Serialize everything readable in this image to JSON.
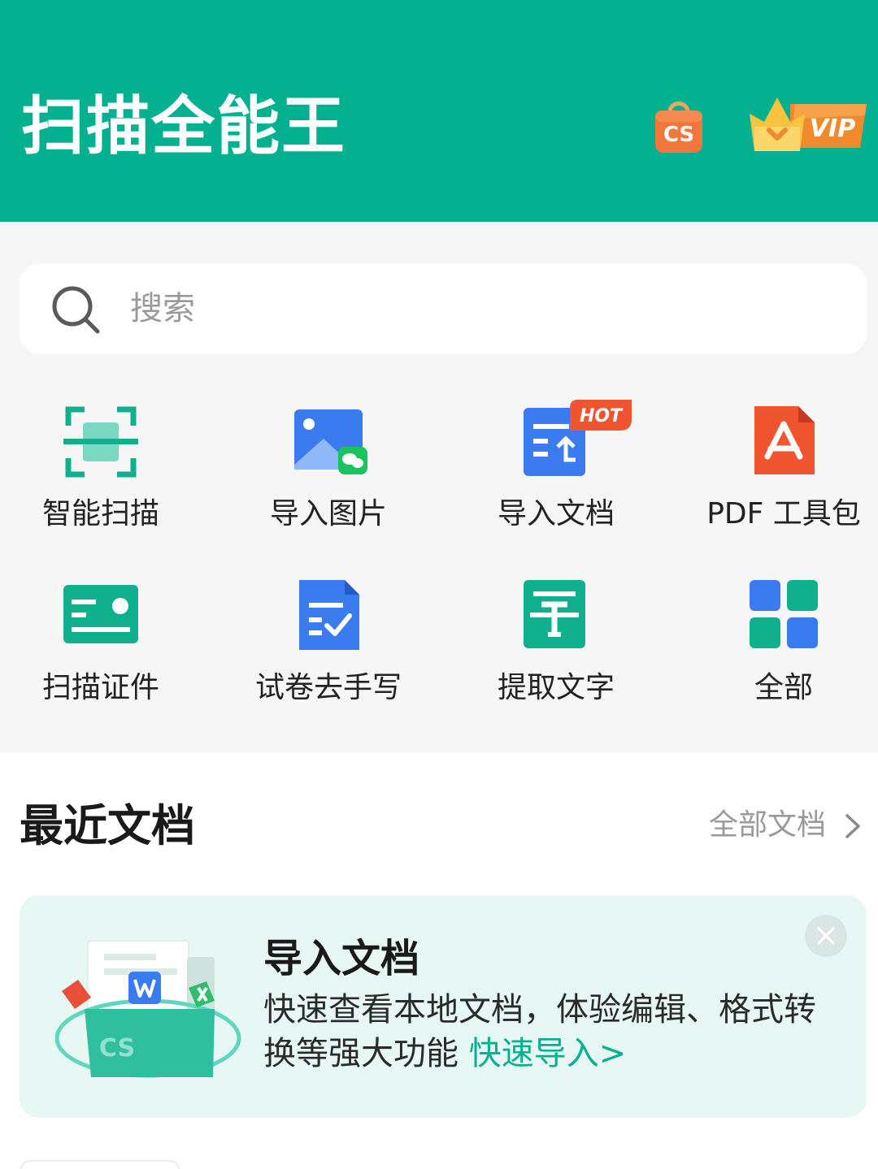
{
  "header": {
    "app_title": "扫描全能王",
    "store_icon": "cs-store-bag-icon",
    "store_label": "CS",
    "vip_icon": "vip-crown-badge",
    "vip_label": "VIP"
  },
  "search": {
    "placeholder": "搜索",
    "icon": "search-icon"
  },
  "tools": [
    {
      "label": "智能扫描",
      "icon": "smart-scan-icon"
    },
    {
      "label": "导入图片",
      "icon": "import-image-icon"
    },
    {
      "label": "导入文档",
      "icon": "import-document-icon",
      "badge": "HOT"
    },
    {
      "label": "PDF 工具包",
      "icon": "pdf-toolkit-icon"
    },
    {
      "label": "扫描证件",
      "icon": "scan-id-card-icon"
    },
    {
      "label": "试卷去手写",
      "icon": "remove-handwriting-icon"
    },
    {
      "label": "提取文字",
      "icon": "extract-text-icon"
    },
    {
      "label": "全部",
      "icon": "all-tools-grid-icon"
    }
  ],
  "recent": {
    "title": "最近文档",
    "all_docs_label": "全部文档"
  },
  "promo": {
    "title": "导入文档",
    "description": "快速查看本地文档，体验编辑、格式转换等强大功能",
    "link_label": "快速导入>",
    "illustration_label": "CS",
    "close_icon": "close-icon"
  },
  "colors": {
    "brand": "#03b08f",
    "background": "#f6f6f6",
    "card": "#ffffff",
    "promo_bg": "#e7f7f3",
    "hot_badge": "#f0552f",
    "pdf_red": "#f0552f",
    "blue": "#3a7cf0"
  }
}
